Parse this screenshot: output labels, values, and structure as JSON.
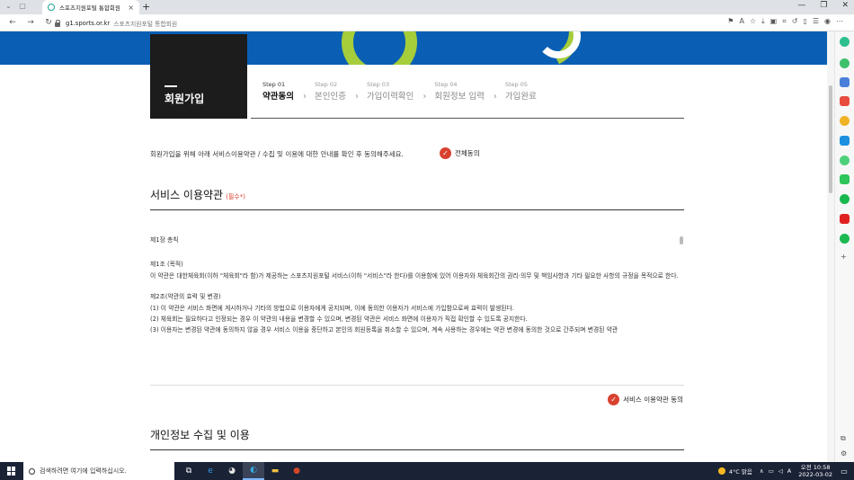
{
  "browser": {
    "tab_title": "스포츠지원포털 통합회원",
    "tab_close": "×",
    "new_tab": "+",
    "url": "g1.sports.or.kr",
    "url_page_title": "스포츠지원포털 통합회원",
    "nav_back": "←",
    "nav_forward": "→",
    "nav_reload": "↻",
    "window_minimize": "—",
    "window_restore": "❐",
    "window_close": "✕"
  },
  "page": {
    "signup_title": "회원가입",
    "steps": [
      {
        "num": "Step 01",
        "name": "약관동의",
        "active": true
      },
      {
        "num": "Step 02",
        "name": "본인인증",
        "active": false
      },
      {
        "num": "Step 03",
        "name": "가입이력확인",
        "active": false
      },
      {
        "num": "Step 04",
        "name": "회원정보 입력",
        "active": false
      },
      {
        "num": "Step 05",
        "name": "가입완료",
        "active": false
      }
    ],
    "intro_text": "회원가입을 위해 아래 서비스이용약관 / 수집 및 이용에 대한 안내를 확인 후 동의해주세요.",
    "agree_all_label": "전체동의",
    "terms_section": {
      "title": "서비스 이용약관",
      "required": "(필수*)",
      "chapter": "제1장 총칙",
      "article1_title": "제1조 (목적)",
      "article1_body": "이 약관은 대한체육회(이하 \"체육회\"라 함)가 제공하는 스포츠지원포털 서비스(이하 \"서비스\"라 한다)를 이용함에 있어 이용자와 체육회간의 권리·의무 및 책임사항과 기타 필요한 사항의 규정을 목적으로 한다.",
      "article2_title": "제2조(약관의 효력 및 변경)",
      "article2_items": [
        "(1) 이 약관은 서비스 화면에 게시하거나 기타의 방법으로 이용자에게 공지되며, 이에 동의한 이용자가 서비스에 가입함으로써 효력이 발생된다.",
        "(2) 체육회는 필요하다고 인정되는 경우 이 약관의 내용을 변경할 수 있으며, 변경된 약관은 서비스 화면에 이용자가 직접 확인할 수 있도록 공지한다.",
        "(3) 이용자는 변경된 약관에 동의하지 않을 경우 서비스 이용을 중단하고 본인의 회원등록을 취소할 수 있으며, 계속 사용하는 경우에는 약관 변경에 동의한 것으로 간주되며 변경된 약관"
      ],
      "agree_label": "서비스 이용약관 동의"
    },
    "privacy_section": {
      "title": "개인정보 수집 및 이용"
    },
    "check_mark": "✓"
  },
  "taskbar": {
    "search_placeholder": "검색하려면 여기에 입력하십시오.",
    "weather": "4°C 맑음",
    "time": "오전 10:58",
    "date": "2022-03-02",
    "notification": "▭"
  },
  "colors": {
    "banner_blue": "#0a5fb4",
    "accent_green": "#a6cd3a",
    "check_red": "#d9422f"
  }
}
